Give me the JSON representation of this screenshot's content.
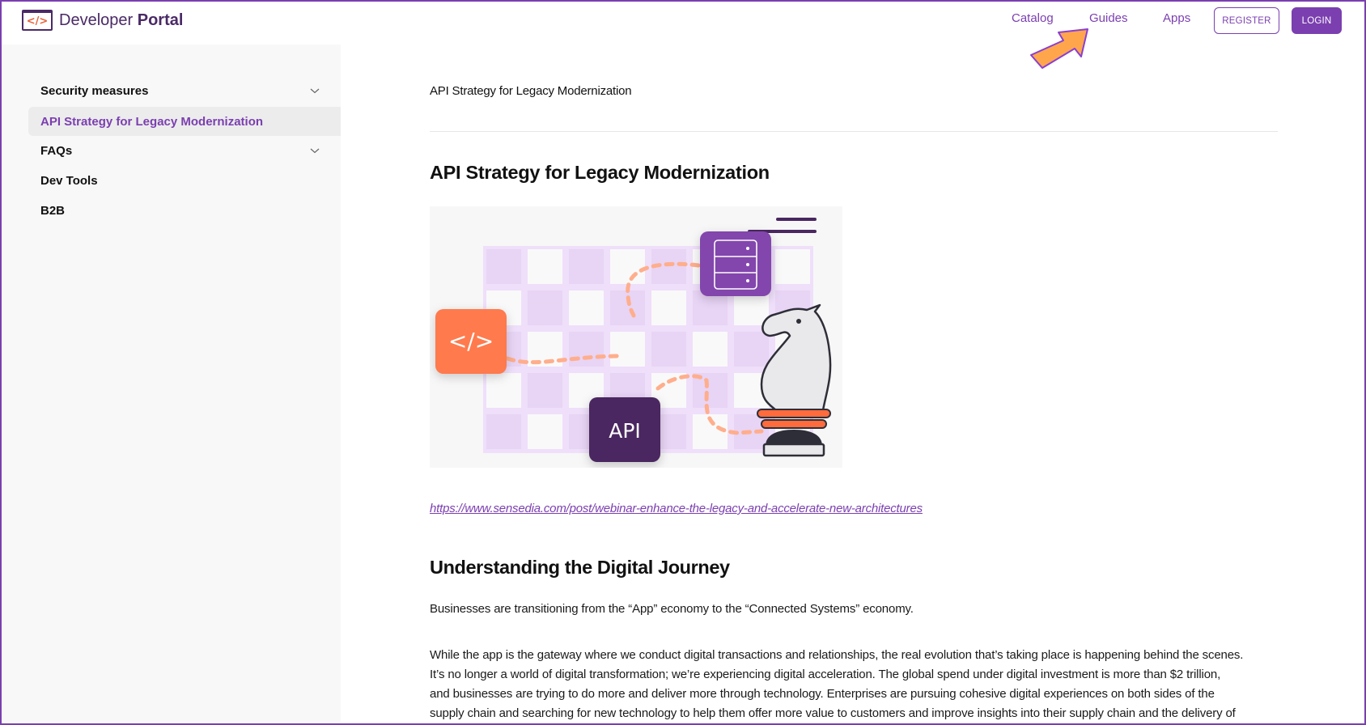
{
  "header": {
    "logo_text_regular": "Developer",
    "logo_text_bold": "Portal",
    "logo_icon": "code-brackets-icon",
    "nav": [
      {
        "label": "Catalog"
      },
      {
        "label": "Guides"
      },
      {
        "label": "Apps"
      }
    ],
    "register_label": "REGISTER",
    "login_label": "LOGIN",
    "annotation_icon": "orange-arrow-pointer-icon"
  },
  "sidebar": {
    "items": [
      {
        "label": "Security measures",
        "expandable": true,
        "active": false
      },
      {
        "label": "API Strategy for Legacy Modernization",
        "expandable": false,
        "active": true
      },
      {
        "label": "FAQs",
        "expandable": true,
        "active": false
      },
      {
        "label": "Dev Tools",
        "expandable": false,
        "active": false
      },
      {
        "label": "B2B",
        "expandable": false,
        "active": false
      }
    ]
  },
  "main": {
    "breadcrumb": "API Strategy for Legacy Modernization",
    "title": "API Strategy for Legacy Modernization",
    "hero": {
      "code_tile": "</>",
      "api_tile": "API",
      "description": "chessboard illustration with code, API, server tiles and knight piece"
    },
    "link": "https://www.sensedia.com/post/webinar-enhance-the-legacy-and-accelerate-new-architectures",
    "section_title": "Understanding the Digital Journey",
    "paragraph1": "Businesses are transitioning from the “App” economy to the “Connected Systems” economy.",
    "paragraph2_lines": [
      "While the app is the gateway where we conduct digital transactions and relationships, the real evolution that’s taking place is happening behind the scenes.",
      "It’s no longer a world of digital transformation; we’re experiencing digital acceleration. The global spend under digital investment is more than $2 trillion,",
      "and businesses are trying to do more and deliver more through technology. Enterprises are pursuing cohesive digital experiences on both sides of the",
      "supply chain and searching for new technology to help them offer more value to customers and improve insights into their supply chain and the delivery of"
    ]
  },
  "colors": {
    "accent": "#7b3fb0",
    "logo_dark": "#4a2a66",
    "code_tile": "#ff7a4d",
    "api_tile": "#4a2760",
    "server_tile": "#8246ad",
    "arrow": "#ffa64d"
  }
}
